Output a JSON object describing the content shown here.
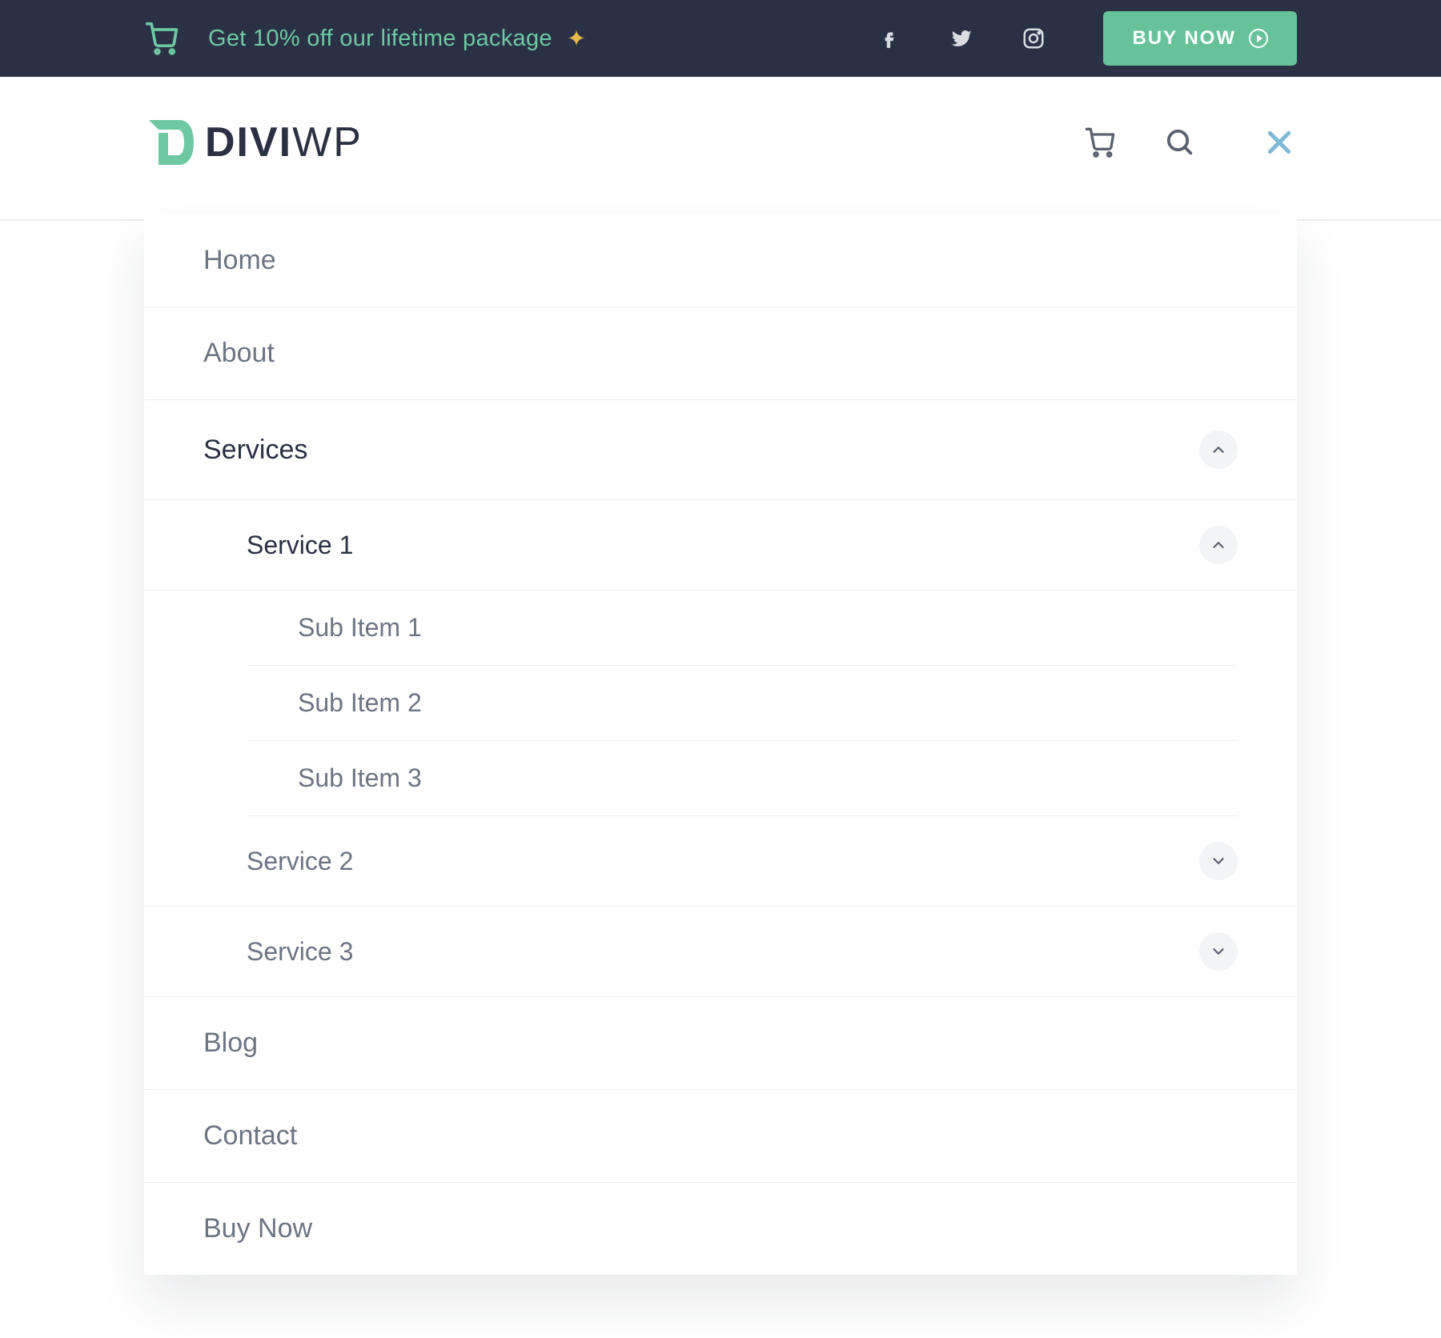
{
  "colors": {
    "accent": "#6ec9a3",
    "dark_bg": "#2a3144",
    "close_icon": "#7db9d6"
  },
  "topbar": {
    "promo_text": "Get 10% off our lifetime package",
    "sparkle": "✦",
    "social_icons": [
      "facebook-icon",
      "twitter-icon",
      "instagram-icon"
    ],
    "buy_label": "BUY NOW"
  },
  "header": {
    "brand_primary": "DIVI",
    "brand_secondary": "WP",
    "icons": [
      "cart-icon",
      "search-icon",
      "close-icon"
    ]
  },
  "menu": {
    "items": [
      {
        "label": "Home"
      },
      {
        "label": "About"
      },
      {
        "label": "Services",
        "expanded": true,
        "children": [
          {
            "label": "Service 1",
            "expanded": true,
            "children": [
              {
                "label": "Sub Item 1"
              },
              {
                "label": "Sub Item 2"
              },
              {
                "label": "Sub Item 3"
              }
            ]
          },
          {
            "label": "Service 2",
            "expanded": false
          },
          {
            "label": "Service 3",
            "expanded": false
          }
        ]
      },
      {
        "label": "Blog"
      },
      {
        "label": "Contact"
      },
      {
        "label": "Buy Now"
      }
    ]
  }
}
